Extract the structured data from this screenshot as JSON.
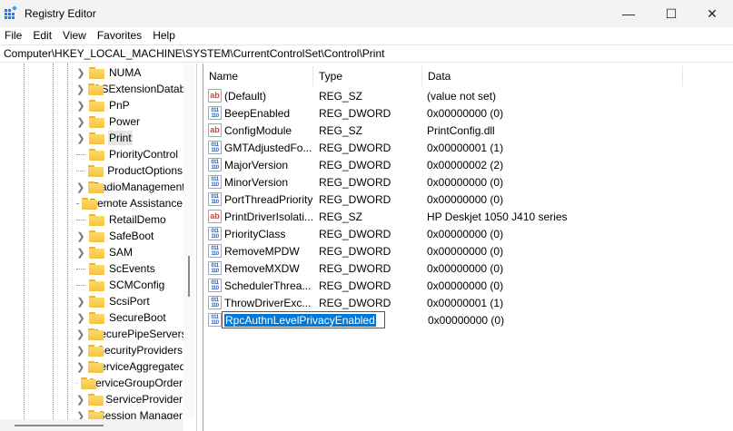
{
  "window": {
    "title": "Registry Editor",
    "minimize": "—",
    "maximize": "☐",
    "close": "✕"
  },
  "menu": [
    "File",
    "Edit",
    "View",
    "Favorites",
    "Help"
  ],
  "address": "Computer\\HKEY_LOCAL_MACHINE\\SYSTEM\\CurrentControlSet\\Control\\Print",
  "tree": [
    {
      "label": "NUMA",
      "expandable": true
    },
    {
      "label": "OSExtensionDatabase",
      "expandable": true
    },
    {
      "label": "PnP",
      "expandable": true
    },
    {
      "label": "Power",
      "expandable": true
    },
    {
      "label": "Print",
      "expandable": true,
      "selected": true
    },
    {
      "label": "PriorityControl",
      "expandable": false
    },
    {
      "label": "ProductOptions",
      "expandable": false
    },
    {
      "label": "RadioManagement",
      "expandable": true
    },
    {
      "label": "Remote Assistance",
      "expandable": false
    },
    {
      "label": "RetailDemo",
      "expandable": false
    },
    {
      "label": "SafeBoot",
      "expandable": true
    },
    {
      "label": "SAM",
      "expandable": true
    },
    {
      "label": "ScEvents",
      "expandable": false
    },
    {
      "label": "SCMConfig",
      "expandable": false
    },
    {
      "label": "ScsiPort",
      "expandable": true
    },
    {
      "label": "SecureBoot",
      "expandable": true
    },
    {
      "label": "SecurePipeServers",
      "expandable": true
    },
    {
      "label": "SecurityProviders",
      "expandable": true
    },
    {
      "label": "ServiceAggregatedEvents",
      "expandable": true
    },
    {
      "label": "ServiceGroupOrder",
      "expandable": false
    },
    {
      "label": "ServiceProvider",
      "expandable": true
    },
    {
      "label": "Session Manager",
      "expandable": true
    }
  ],
  "columns": {
    "name": "Name",
    "type": "Type",
    "data": "Data"
  },
  "values": [
    {
      "name": "(Default)",
      "type": "REG_SZ",
      "data": "(value not set)",
      "icon": "ab"
    },
    {
      "name": "BeepEnabled",
      "type": "REG_DWORD",
      "data": "0x00000000 (0)",
      "icon": "dword"
    },
    {
      "name": "ConfigModule",
      "type": "REG_SZ",
      "data": "PrintConfig.dll",
      "icon": "ab"
    },
    {
      "name": "GMTAdjustedFo...",
      "type": "REG_DWORD",
      "data": "0x00000001 (1)",
      "icon": "dword"
    },
    {
      "name": "MajorVersion",
      "type": "REG_DWORD",
      "data": "0x00000002 (2)",
      "icon": "dword"
    },
    {
      "name": "MinorVersion",
      "type": "REG_DWORD",
      "data": "0x00000000 (0)",
      "icon": "dword"
    },
    {
      "name": "PortThreadPriority",
      "type": "REG_DWORD",
      "data": "0x00000000 (0)",
      "icon": "dword"
    },
    {
      "name": "PrintDriverIsolati...",
      "type": "REG_SZ",
      "data": "HP Deskjet 1050 J410 series",
      "icon": "ab"
    },
    {
      "name": "PriorityClass",
      "type": "REG_DWORD",
      "data": "0x00000000 (0)",
      "icon": "dword"
    },
    {
      "name": "RemoveMPDW",
      "type": "REG_DWORD",
      "data": "0x00000000 (0)",
      "icon": "dword"
    },
    {
      "name": "RemoveMXDW",
      "type": "REG_DWORD",
      "data": "0x00000000 (0)",
      "icon": "dword"
    },
    {
      "name": "SchedulerThrea...",
      "type": "REG_DWORD",
      "data": "0x00000000 (0)",
      "icon": "dword"
    },
    {
      "name": "ThrowDriverExc...",
      "type": "REG_DWORD",
      "data": "0x00000001 (1)",
      "icon": "dword"
    }
  ],
  "editing": {
    "name": "RpcAuthnLevelPrivacyEnabled",
    "data": "0x00000000 (0)"
  },
  "icons": {
    "ab": "ab",
    "dword": "011\n110"
  }
}
